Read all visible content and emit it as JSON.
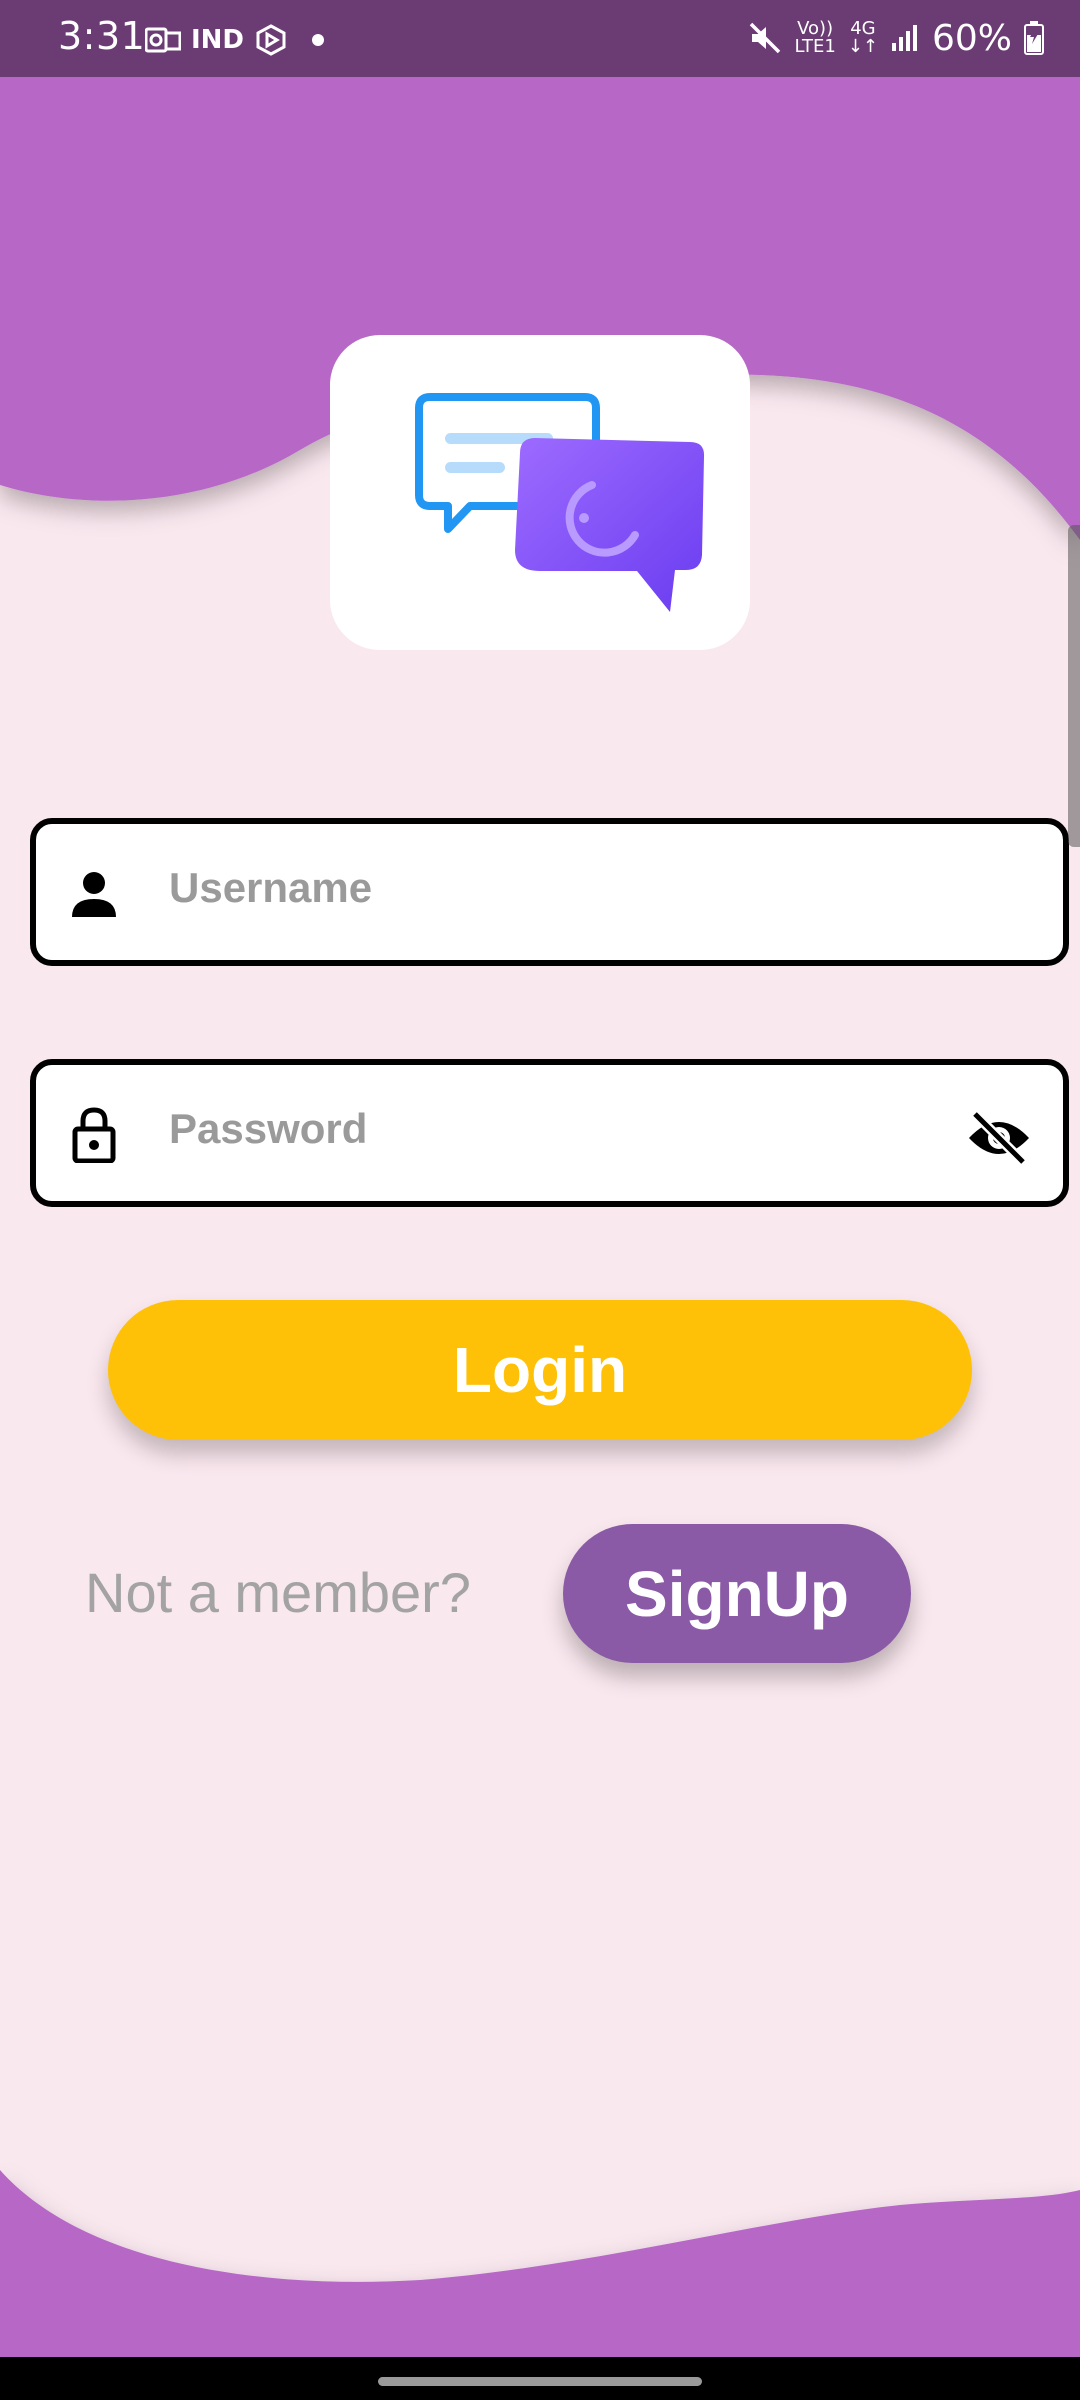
{
  "status_bar": {
    "time": "3:31",
    "carrier_badge": "IND",
    "net_volte": "Vo))",
    "net_lte": "LTE1",
    "net_type": "4G",
    "battery": "60%"
  },
  "login_form": {
    "username_placeholder": "Username",
    "password_placeholder": "Password",
    "login_label": "Login"
  },
  "signup_row": {
    "prompt": "Not a member?",
    "signup_label": "SignUp"
  },
  "colors": {
    "status_bar": "#6b3c74",
    "wave": "#b768c7",
    "background": "#fae8ef",
    "login_button": "#ffc107",
    "signup_button": "#8a5aa6"
  },
  "icons": [
    "chat-bubbles-logo-icon",
    "person-icon",
    "lock-icon",
    "eye-off-icon",
    "mute-icon",
    "signal-icon",
    "battery-icon"
  ]
}
